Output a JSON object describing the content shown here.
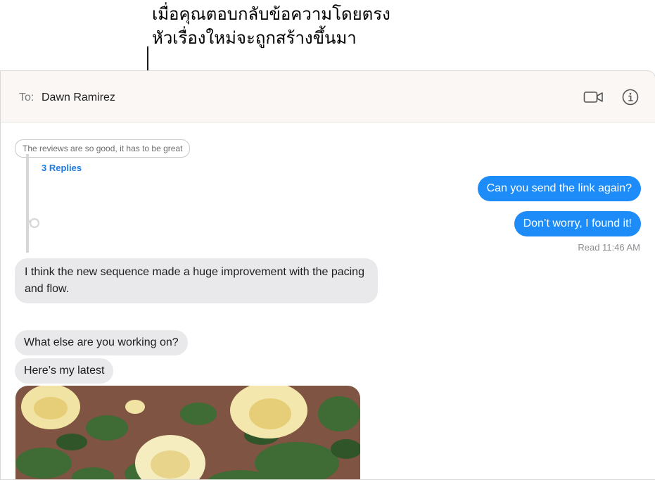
{
  "callout": {
    "line1": "เมื่อคุณตอบกลับข้อความโดยตรง",
    "line2": "หัวเรื่องใหม่จะถูกสร้างขึ้นมา"
  },
  "header": {
    "to_label": "To:",
    "recipient": "Dawn Ramirez",
    "video_icon": "video-camera-icon",
    "info_icon": "info-icon"
  },
  "thread": {
    "quoted_text": "The reviews are so good, it has to be great",
    "replies_label": "3 Replies"
  },
  "messages": {
    "out1": "Can you send the link again?",
    "out2": "Don’t worry, I found it!",
    "read_receipt": "Read 11:46 AM",
    "in1": "I think the new sequence made a huge improvement with the pacing and flow.",
    "in2": "What else are you working on?",
    "in3": "Here’s my latest"
  },
  "colors": {
    "outgoing_bubble": "#1d8cf8",
    "incoming_bubble": "#e9e9eb",
    "link_blue": "#1f7ae0",
    "header_bg": "#fbf7f4"
  }
}
